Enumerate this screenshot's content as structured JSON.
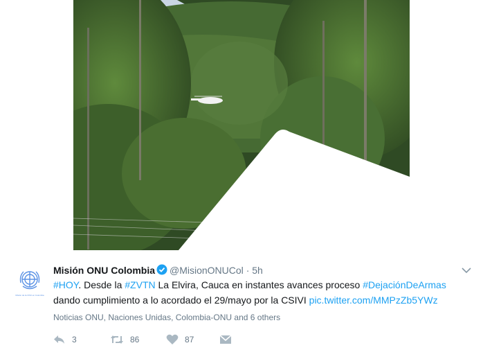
{
  "tweet": {
    "author_name": "Misión ONU Colombia",
    "handle": "@MisionONUCol",
    "separator": "·",
    "time": "5h",
    "text_parts": [
      {
        "text": "#HOY",
        "link": true
      },
      {
        "text": ". Desde la ",
        "link": false
      },
      {
        "text": "#ZVTN",
        "link": true
      },
      {
        "text": " La Elvira, Cauca en instantes avances proceso ",
        "link": false
      },
      {
        "text": "#DejaciónDeArmas",
        "link": true
      },
      {
        "text": " dando cumplimiento a lo acordado el 29/mayo por la CSIVI ",
        "link": false
      },
      {
        "text": "pic.twitter.com/MMPzZb5YWz",
        "link": true
      }
    ],
    "mentions": "Noticias ONU, Naciones Unidas, Colombia-ONU and 6 others",
    "avatar_caption": "Misión de la ONU en Colombia",
    "actions": {
      "reply_count": "3",
      "retweet_count": "86",
      "like_count": "87"
    }
  },
  "icons": {
    "verified": "verified-badge-icon",
    "caret": "chevron-down-icon",
    "reply": "reply-icon",
    "retweet": "retweet-icon",
    "like": "heart-icon",
    "message": "direct-message-icon"
  },
  "colors": {
    "link": "#1da1f2",
    "muted": "#657786",
    "verified": "#1da1f2",
    "un_blue": "#5b92e5"
  }
}
